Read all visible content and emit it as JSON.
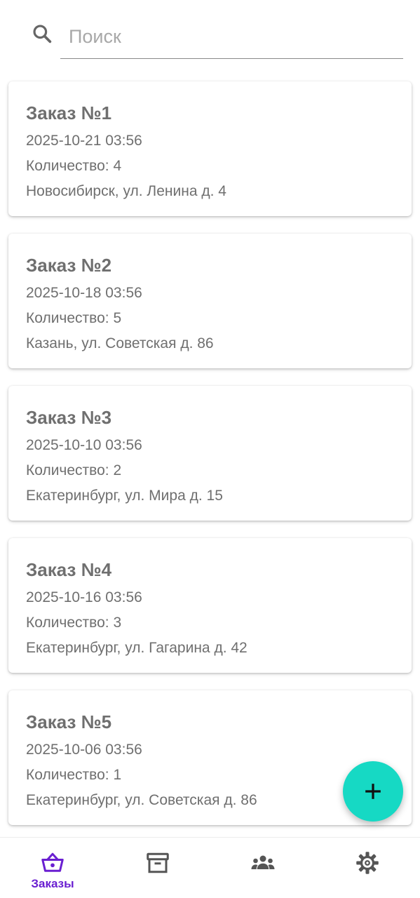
{
  "search": {
    "placeholder": "Поиск",
    "value": ""
  },
  "orders": [
    {
      "title": "Заказ №1",
      "date": "2025-10-21 03:56",
      "quantity": "Количество: 4",
      "address": "Новосибирск, ул. Ленина д. 4"
    },
    {
      "title": "Заказ №2",
      "date": "2025-10-18 03:56",
      "quantity": "Количество: 5",
      "address": "Казань, ул. Советская д. 86"
    },
    {
      "title": "Заказ №3",
      "date": "2025-10-10 03:56",
      "quantity": "Количество: 2",
      "address": "Екатеринбург, ул. Мира д. 15"
    },
    {
      "title": "Заказ №4",
      "date": "2025-10-16 03:56",
      "quantity": "Количество: 3",
      "address": "Екатеринбург, ул. Гагарина д. 42"
    },
    {
      "title": "Заказ №5",
      "date": "2025-10-06 03:56",
      "quantity": "Количество: 1",
      "address": "Екатеринбург, ул. Советская д. 86"
    }
  ],
  "fab": {
    "icon": "plus-icon",
    "color": "#16d9c4"
  },
  "bottom_nav": {
    "active_color": "#6a1fd1",
    "inactive_color": "#555555",
    "items": [
      {
        "icon": "basket-icon",
        "label": "Заказы",
        "active": true
      },
      {
        "icon": "archive-icon",
        "label": "",
        "active": false
      },
      {
        "icon": "people-icon",
        "label": "",
        "active": false
      },
      {
        "icon": "gear-icon",
        "label": "",
        "active": false
      }
    ]
  }
}
